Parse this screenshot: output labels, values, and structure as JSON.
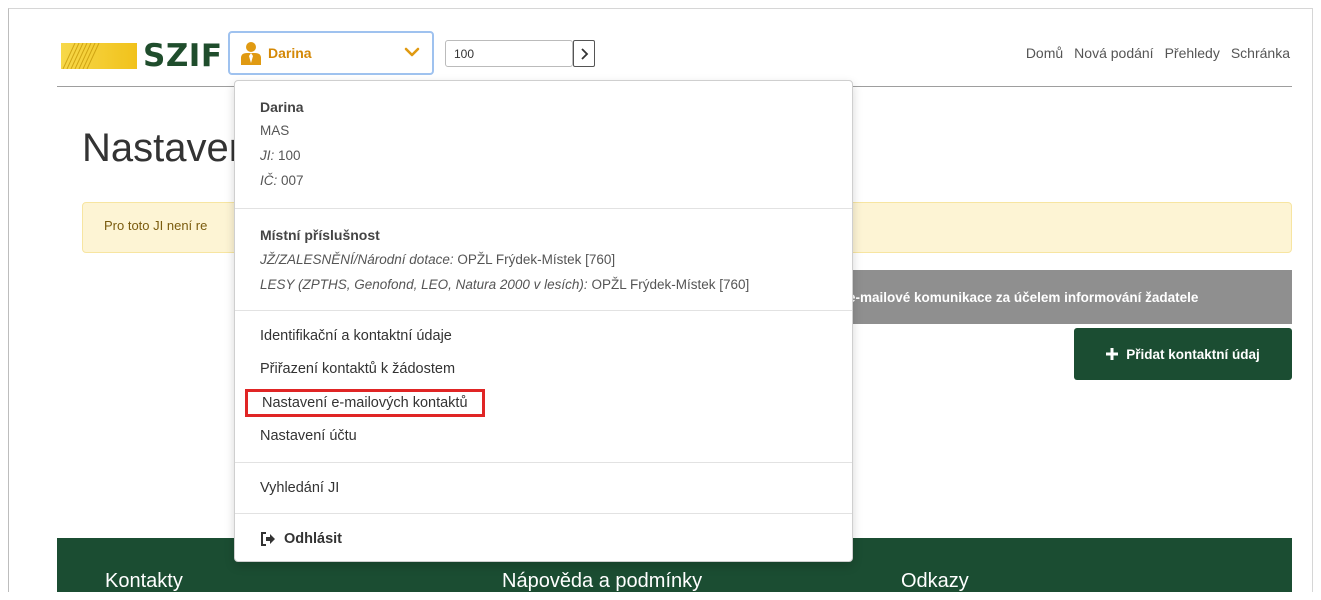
{
  "header": {
    "logo_text": "SZIF",
    "user_name": "Darina",
    "ji_value": "100",
    "nav": [
      "Domů",
      "Nová podání",
      "Přehledy",
      "Schránka"
    ]
  },
  "page": {
    "title": "Nastaven",
    "alert": "Pro toto JI není re",
    "grey_bar": "e-mailové komunikace za účelem informování žadatele",
    "add_button": "Přidat kontaktní údaj"
  },
  "footer": {
    "columns": [
      "Kontakty",
      "Nápověda a podmínky",
      "Odkazy"
    ]
  },
  "dropdown": {
    "profile": {
      "name": "Darina",
      "type": "MAS",
      "ji_label": "JI:",
      "ji_value": "100",
      "ic_label": "IČ:",
      "ic_value": "007"
    },
    "jurisdiction": {
      "heading": "Místní příslušnost",
      "rows": [
        {
          "label": "JŽ/ZALESNĚNÍ/Národní dotace:",
          "value": "OPŽL Frýdek-Místek [760]"
        },
        {
          "label": "LESY (ZPTHS, Genofond, LEO, Natura 2000 v lesích):",
          "value": "OPŽL Frýdek-Místek [760]"
        }
      ]
    },
    "menu": [
      "Identifikační a kontaktní údaje",
      "Přiřazení kontaktů k žádostem",
      "Nastavení e-mailových kontaktů",
      "Nastavení účtu"
    ],
    "search": "Vyhledání JI",
    "logout": "Odhlásit"
  },
  "colors": {
    "brand_green": "#1b4d32",
    "user_orange": "#d48806",
    "alert_bg": "#fdf4d4",
    "highlight_red": "#e02525"
  },
  "icons": {
    "logo": "szif-stripes-logo",
    "user": "user-tie-icon",
    "caret": "chevron-down-icon",
    "go": "chevron-right-icon",
    "add": "plus-icon",
    "logout": "sign-out-icon"
  }
}
